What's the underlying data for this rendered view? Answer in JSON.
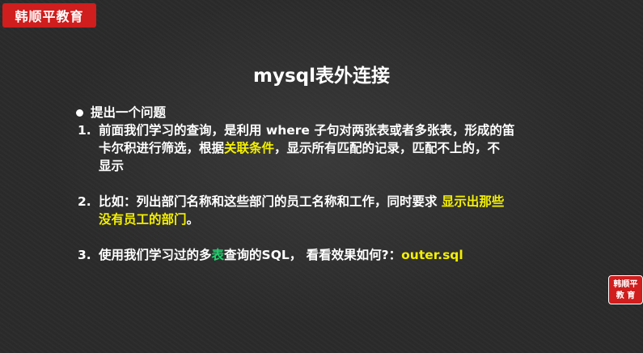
{
  "brand": {
    "name": "韩顺平教育"
  },
  "slide": {
    "title": "mysql表外连接",
    "bullet": "提出一个问题",
    "items": [
      {
        "num": "1.",
        "lines": [
          "前面我们学习的查询，是利用 where 子句对两张表或者多张表，形成的笛",
          "卡尔积进行筛选，根据",
          "关联条件",
          "，显示所有匹配的记录，匹配不上的，不",
          "显示"
        ]
      },
      {
        "num": "2.",
        "parts": [
          "比如：列出部门名称和这些部门的员工名称和工作，同时要求 ",
          "显示出那些",
          "没有员工的部门",
          "。"
        ]
      },
      {
        "num": "3.",
        "parts": [
          "使用我们学习过的多",
          "表",
          "查询的SQL， 看看效果如何?：",
          "outer.sql"
        ]
      }
    ]
  },
  "corner_logo": {
    "line1": "韩顺平",
    "line2": "教  育"
  },
  "colors": {
    "highlight": "#f4f000",
    "brand": "#d01d1d",
    "green": "#1fd16b"
  }
}
